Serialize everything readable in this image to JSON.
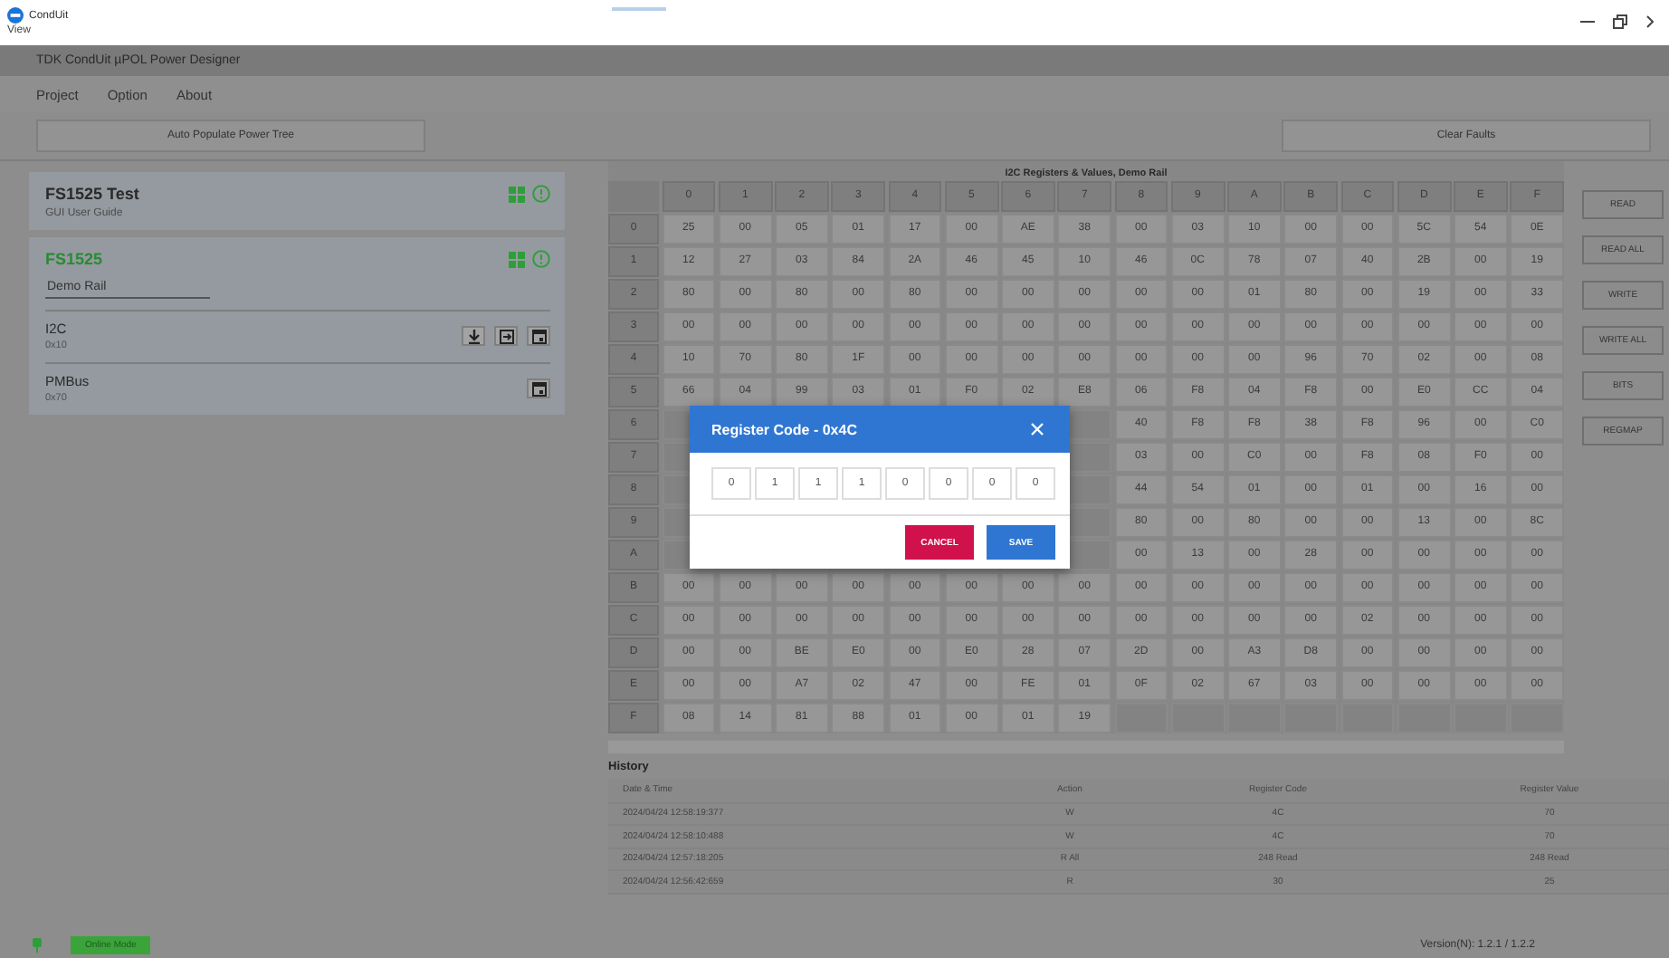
{
  "window": {
    "app_name": "CondUit",
    "menu": "View"
  },
  "app_title": "TDK CondUit µPOL Power Designer",
  "menu": [
    "Project",
    "Option",
    "About"
  ],
  "toolbar": {
    "left_button": "Auto Populate Power Tree",
    "right_button": "Clear Faults"
  },
  "projects": [
    {
      "title": "FS1525 Test",
      "subtitle": "GUI User Guide",
      "selected": false
    },
    {
      "title": "FS1525",
      "rail_field": "Demo Rail",
      "selected": true,
      "buses": [
        {
          "name": "I2C",
          "address": "0x10",
          "tools": [
            {
              "kind": "download"
            },
            {
              "kind": "import"
            },
            {
              "kind": "save"
            }
          ]
        },
        {
          "name": "PMBus",
          "address": "0x70",
          "tools": [
            {
              "kind": "save"
            }
          ]
        }
      ]
    }
  ],
  "registers": {
    "title": "I2C Registers & Values, Demo Rail",
    "columns": [
      "0",
      "1",
      "2",
      "3",
      "4",
      "5",
      "6",
      "7",
      "8",
      "9",
      "A",
      "B",
      "C",
      "D",
      "E",
      "F"
    ],
    "rows": [
      {
        "label": "0",
        "cells": [
          "25",
          "00",
          "05",
          "01",
          "17",
          "00",
          "AE",
          "38",
          "00",
          "03",
          "10",
          "00",
          "00",
          "5C",
          "54",
          "0E"
        ]
      },
      {
        "label": "1",
        "cells": [
          "12",
          "27",
          "03",
          "84",
          "2A",
          "46",
          "45",
          "10",
          "46",
          "0C",
          "78",
          "07",
          "40",
          "2B",
          "00",
          "19"
        ]
      },
      {
        "label": "2",
        "cells": [
          "80",
          "00",
          "80",
          "00",
          "80",
          "00",
          "00",
          "00",
          "00",
          "00",
          "01",
          "80",
          "00",
          "19",
          "00",
          "33"
        ]
      },
      {
        "label": "3",
        "cells": [
          "00",
          "00",
          "00",
          "00",
          "00",
          "00",
          "00",
          "00",
          "00",
          "00",
          "00",
          "00",
          "00",
          "00",
          "00",
          "00"
        ]
      },
      {
        "label": "4",
        "cells": [
          "10",
          "70",
          "80",
          "1F",
          "00",
          "00",
          "00",
          "00",
          "00",
          "00",
          "00",
          "96",
          "70",
          "02",
          "00",
          "08"
        ]
      },
      {
        "label": "5",
        "cells": [
          "66",
          "04",
          "99",
          "03",
          "01",
          "F0",
          "02",
          "E8",
          "06",
          "F8",
          "04",
          "F8",
          "00",
          "E0",
          "CC",
          "04"
        ]
      },
      {
        "label": "6",
        "cells": [
          null,
          null,
          null,
          null,
          null,
          null,
          null,
          null,
          "40",
          "F8",
          "F8",
          "38",
          "F8",
          "96",
          "00",
          "C0"
        ]
      },
      {
        "label": "7",
        "cells": [
          null,
          null,
          null,
          null,
          null,
          null,
          null,
          null,
          "03",
          "00",
          "C0",
          "00",
          "F8",
          "08",
          "F0",
          "00"
        ]
      },
      {
        "label": "8",
        "cells": [
          null,
          null,
          null,
          null,
          null,
          null,
          null,
          null,
          "44",
          "54",
          "01",
          "00",
          "01",
          "00",
          "16",
          "00"
        ]
      },
      {
        "label": "9",
        "cells": [
          null,
          null,
          null,
          null,
          null,
          null,
          null,
          null,
          "80",
          "00",
          "80",
          "00",
          "00",
          "13",
          "00",
          "8C"
        ]
      },
      {
        "label": "A",
        "cells": [
          null,
          null,
          null,
          null,
          null,
          null,
          null,
          null,
          "00",
          "13",
          "00",
          "28",
          "00",
          "00",
          "00",
          "00"
        ]
      },
      {
        "label": "B",
        "cells": [
          "00",
          "00",
          "00",
          "00",
          "00",
          "00",
          "00",
          "00",
          "00",
          "00",
          "00",
          "00",
          "00",
          "00",
          "00",
          "00"
        ]
      },
      {
        "label": "C",
        "cells": [
          "00",
          "00",
          "00",
          "00",
          "00",
          "00",
          "00",
          "00",
          "00",
          "00",
          "00",
          "00",
          "02",
          "00",
          "00",
          "00"
        ]
      },
      {
        "label": "D",
        "cells": [
          "00",
          "00",
          "BE",
          "E0",
          "00",
          "E0",
          "28",
          "07",
          "2D",
          "00",
          "A3",
          "D8",
          "00",
          "00",
          "00",
          "00"
        ]
      },
      {
        "label": "E",
        "cells": [
          "00",
          "00",
          "A7",
          "02",
          "47",
          "00",
          "FE",
          "01",
          "0F",
          "02",
          "67",
          "03",
          "00",
          "00",
          "00",
          "00"
        ]
      },
      {
        "label": "F",
        "cells": [
          "08",
          "14",
          "81",
          "88",
          "01",
          "00",
          "01",
          "19",
          null,
          null,
          null,
          null,
          null,
          null,
          null,
          null
        ]
      }
    ]
  },
  "side_buttons": [
    "READ",
    "READ ALL",
    "WRITE",
    "WRITE ALL",
    "BITS",
    "REGMAP"
  ],
  "history": {
    "title": "History",
    "columns": [
      "Date & Time",
      "Action",
      "Register Code",
      "Register Value"
    ],
    "rows": [
      [
        "2024/04/24 12:58:19:377",
        "W",
        "4C",
        "70"
      ],
      [
        "2024/04/24 12:58:10:488",
        "W",
        "4C",
        "70"
      ],
      [
        "2024/04/24 12:57:18:205",
        "R All",
        "248 Read",
        "248 Read"
      ],
      [
        "2024/04/24 12:56:42:659",
        "R",
        "30",
        "25"
      ]
    ]
  },
  "dialog": {
    "title": "Register Code - 0x4C",
    "bits": [
      "0",
      "1",
      "1",
      "1",
      "0",
      "0",
      "0",
      "0"
    ],
    "buttons": [
      {
        "label": "CANCEL",
        "kind": "cancel"
      },
      {
        "label": "SAVE",
        "kind": "save"
      }
    ]
  },
  "status": {
    "mode": "Online Mode",
    "version": "Version(N): 1.2.1 / 1.2.2"
  }
}
